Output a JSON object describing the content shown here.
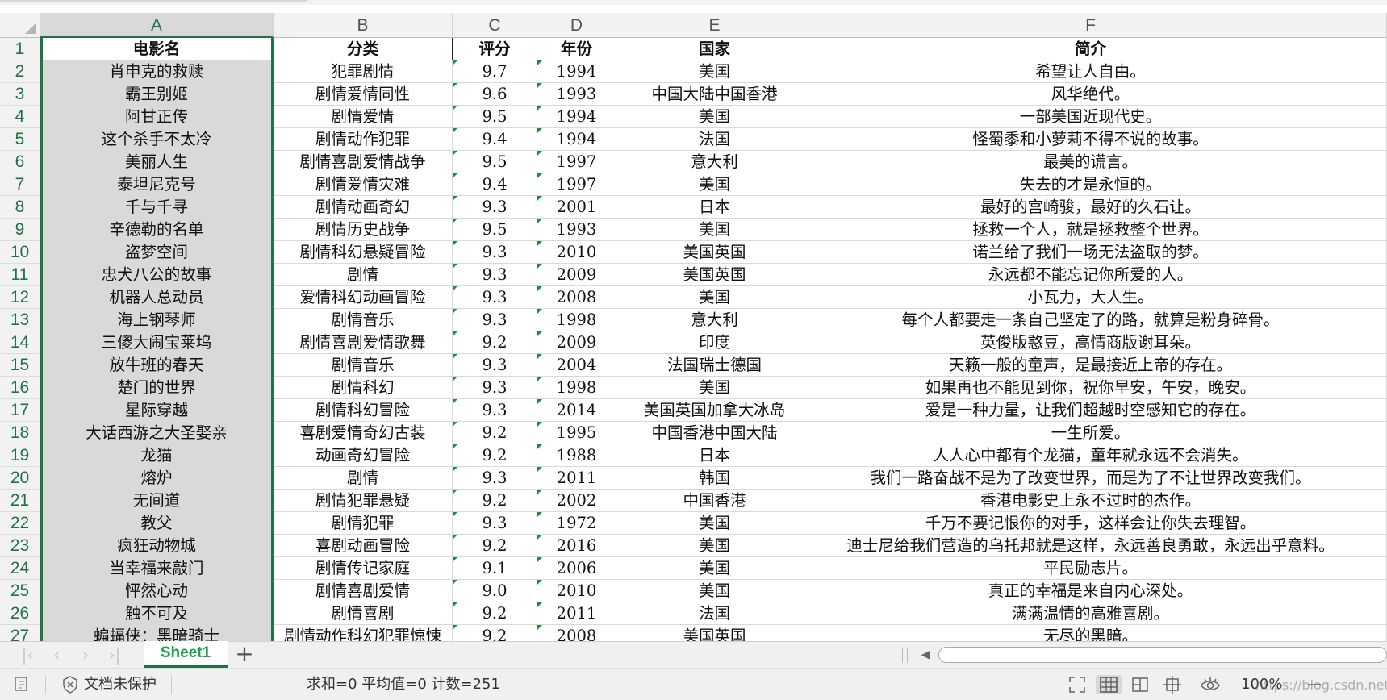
{
  "columns": [
    "A",
    "B",
    "C",
    "D",
    "E",
    "F"
  ],
  "selected_column": "A",
  "header_row": [
    "电影名",
    "分类",
    "评分",
    "年份",
    "国家",
    "简介"
  ],
  "rows": [
    [
      "肖申克的救赎",
      "犯罪剧情",
      "9.7",
      "1994",
      "美国",
      "希望让人自由。"
    ],
    [
      "霸王别姬",
      "剧情爱情同性",
      "9.6",
      "1993",
      "中国大陆中国香港",
      "风华绝代。"
    ],
    [
      "阿甘正传",
      "剧情爱情",
      "9.5",
      "1994",
      "美国",
      "一部美国近现代史。"
    ],
    [
      "这个杀手不太冷",
      "剧情动作犯罪",
      "9.4",
      "1994",
      "法国",
      "怪蜀黍和小萝莉不得不说的故事。"
    ],
    [
      "美丽人生",
      "剧情喜剧爱情战争",
      "9.5",
      "1997",
      "意大利",
      "最美的谎言。"
    ],
    [
      "泰坦尼克号",
      "剧情爱情灾难",
      "9.4",
      "1997",
      "美国",
      "失去的才是永恒的。"
    ],
    [
      "千与千寻",
      "剧情动画奇幻",
      "9.3",
      "2001",
      "日本",
      "最好的宫崎骏，最好的久石让。"
    ],
    [
      "辛德勒的名单",
      "剧情历史战争",
      "9.5",
      "1993",
      "美国",
      "拯救一个人，就是拯救整个世界。"
    ],
    [
      "盗梦空间",
      "剧情科幻悬疑冒险",
      "9.3",
      "2010",
      "美国英国",
      "诺兰给了我们一场无法盗取的梦。"
    ],
    [
      "忠犬八公的故事",
      "剧情",
      "9.3",
      "2009",
      "美国英国",
      "永远都不能忘记你所爱的人。"
    ],
    [
      "机器人总动员",
      "爱情科幻动画冒险",
      "9.3",
      "2008",
      "美国",
      "小瓦力，大人生。"
    ],
    [
      "海上钢琴师",
      "剧情音乐",
      "9.3",
      "1998",
      "意大利",
      "每个人都要走一条自己坚定了的路，就算是粉身碎骨。"
    ],
    [
      "三傻大闹宝莱坞",
      "剧情喜剧爱情歌舞",
      "9.2",
      "2009",
      "印度",
      "英俊版憨豆，高情商版谢耳朵。"
    ],
    [
      "放牛班的春天",
      "剧情音乐",
      "9.3",
      "2004",
      "法国瑞士德国",
      "天籁一般的童声，是最接近上帝的存在。"
    ],
    [
      "楚门的世界",
      "剧情科幻",
      "9.3",
      "1998",
      "美国",
      "如果再也不能见到你，祝你早安，午安，晚安。"
    ],
    [
      "星际穿越",
      "剧情科幻冒险",
      "9.3",
      "2014",
      "美国英国加拿大冰岛",
      "爱是一种力量，让我们超越时空感知它的存在。"
    ],
    [
      "大话西游之大圣娶亲",
      "喜剧爱情奇幻古装",
      "9.2",
      "1995",
      "中国香港中国大陆",
      "一生所爱。"
    ],
    [
      "龙猫",
      "动画奇幻冒险",
      "9.2",
      "1988",
      "日本",
      "人人心中都有个龙猫，童年就永远不会消失。"
    ],
    [
      "熔炉",
      "剧情",
      "9.3",
      "2011",
      "韩国",
      "我们一路奋战不是为了改变世界，而是为了不让世界改变我们。"
    ],
    [
      "无间道",
      "剧情犯罪悬疑",
      "9.2",
      "2002",
      "中国香港",
      "香港电影史上永不过时的杰作。"
    ],
    [
      "教父",
      "剧情犯罪",
      "9.3",
      "1972",
      "美国",
      "千万不要记恨你的对手，这样会让你失去理智。"
    ],
    [
      "疯狂动物城",
      "喜剧动画冒险",
      "9.2",
      "2016",
      "美国",
      "迪士尼给我们营造的乌托邦就是这样，永远善良勇敢，永远出乎意料。"
    ],
    [
      "当幸福来敲门",
      "剧情传记家庭",
      "9.1",
      "2006",
      "美国",
      "平民励志片。"
    ],
    [
      "怦然心动",
      "剧情喜剧爱情",
      "9.0",
      "2010",
      "美国",
      "真正的幸福是来自内心深处。"
    ],
    [
      "触不可及",
      "剧情喜剧",
      "9.2",
      "2011",
      "法国",
      "满满温情的高雅喜剧。"
    ],
    [
      "蝙蝠侠：黑暗骑士",
      "剧情动作科幻犯罪惊悚",
      "9.2",
      "2008",
      "美国英国",
      "无尽的黑暗。"
    ]
  ],
  "row_numbers_start": 1,
  "sheet_tab": "Sheet1",
  "add_sheet_label": "+",
  "status": {
    "protection": "文档未保护",
    "summary": "求和=0  平均值=0  计数=251",
    "zoom": "100%",
    "zoom_minus": "—",
    "watermark": "https://blog.csdn.net/weixin"
  },
  "colors": {
    "accent": "#217346",
    "tab_text": "#1aa34a",
    "selected_col_bg": "#d9d9d9"
  },
  "icons": [
    "first-sheet-icon",
    "prev-sheet-icon",
    "next-sheet-icon",
    "last-sheet-icon",
    "doc-icon",
    "shield-icon",
    "fullscreen-icon",
    "normal-view-icon",
    "page-break-view-icon",
    "reading-view-icon",
    "eye-protection-icon"
  ]
}
